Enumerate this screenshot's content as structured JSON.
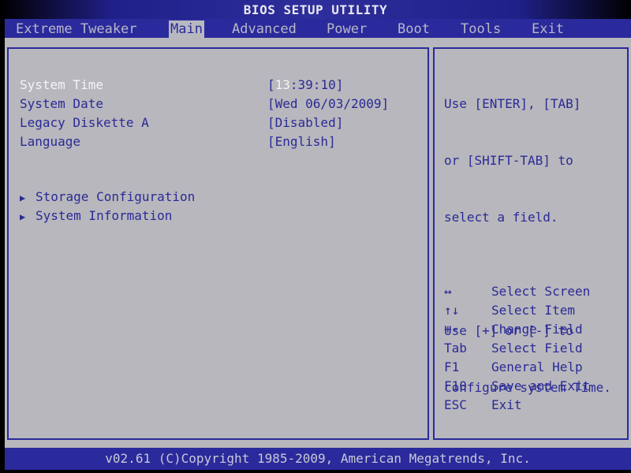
{
  "window": {
    "title": "BIOS SETUP UTILITY"
  },
  "menu": {
    "tabs": [
      {
        "label": "Extreme Tweaker",
        "active": false
      },
      {
        "label": "Main",
        "active": true
      },
      {
        "label": "Advanced",
        "active": false
      },
      {
        "label": "Power",
        "active": false
      },
      {
        "label": "Boot",
        "active": false
      },
      {
        "label": "Tools",
        "active": false
      },
      {
        "label": "Exit",
        "active": false
      }
    ]
  },
  "main": {
    "settings": [
      {
        "label": "System Time",
        "value_prefix": "[",
        "value_highlight": "13",
        "value_rest": ":39:10]",
        "selected": true
      },
      {
        "label": "System Date",
        "value": "[Wed 06/03/2009]"
      },
      {
        "label": "Legacy Diskette A",
        "value": "[Disabled]"
      },
      {
        "label": "Language",
        "value": "[English]"
      }
    ],
    "submenus": [
      {
        "label": "Storage Configuration",
        "icon": "right-triangle"
      },
      {
        "label": "System Information",
        "icon": "right-triangle"
      }
    ]
  },
  "help": {
    "lines": [
      "Use [ENTER], [TAB]",
      "or [SHIFT-TAB] to",
      "select a field.",
      "",
      "Use [+] or [-] to",
      "configure system Time."
    ],
    "keys": [
      {
        "key": "↔",
        "action": "Select Screen"
      },
      {
        "key": "↑↓",
        "action": "Select Item"
      },
      {
        "key": "+-",
        "action": "Change Field"
      },
      {
        "key": "Tab",
        "action": "Select Field"
      },
      {
        "key": "F1",
        "action": "General Help"
      },
      {
        "key": "F10",
        "action": "Save and Exit"
      },
      {
        "key": "ESC",
        "action": "Exit"
      }
    ]
  },
  "footer": {
    "text": "v02.61 (C)Copyright 1985-2009, American Megatrends, Inc."
  },
  "colors": {
    "bios_blue": "#2a2a9c",
    "panel_gray": "#b8b7bd",
    "highlight_white": "#f4f4f4"
  }
}
